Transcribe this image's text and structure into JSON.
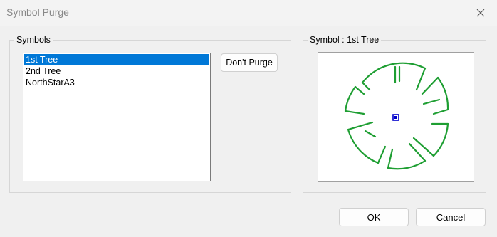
{
  "window": {
    "title": "Symbol Purge",
    "close_icon": "close-icon"
  },
  "symbols_group": {
    "label": "Symbols",
    "items": [
      "1st Tree",
      "2nd Tree",
      "NorthStarA3"
    ],
    "selected_index": 0,
    "dont_purge_label": "Don't Purge"
  },
  "preview_group": {
    "label": "Symbol : 1st Tree",
    "symbol_color": "#1e9e32",
    "center_marker_color": "#0000cc"
  },
  "buttons": {
    "ok": "OK",
    "cancel": "Cancel"
  }
}
